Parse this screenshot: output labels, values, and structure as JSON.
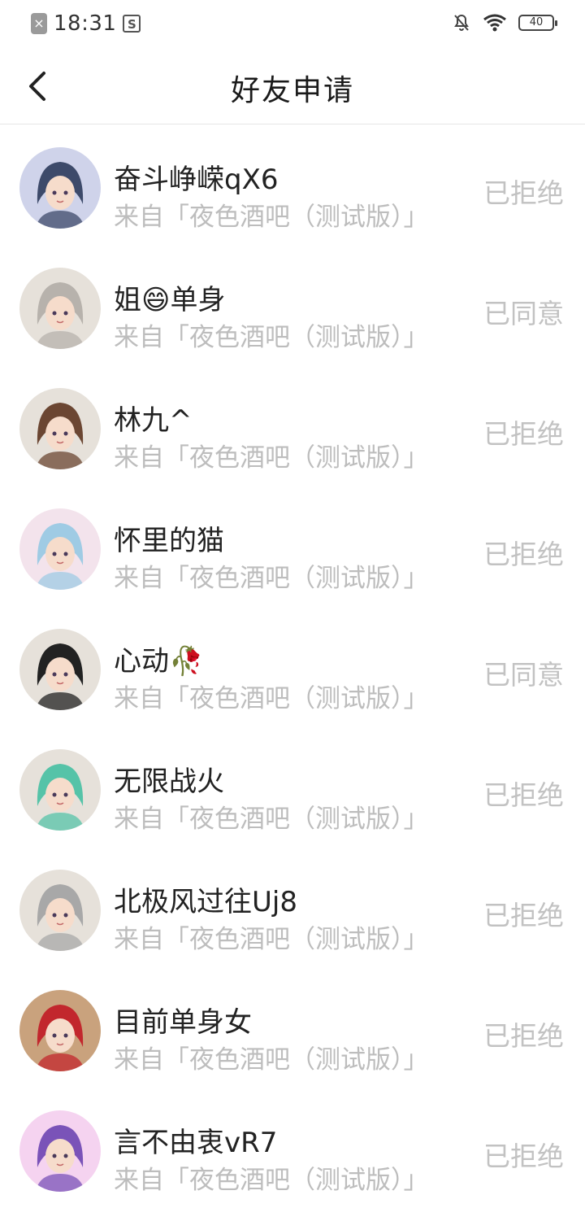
{
  "status_bar": {
    "time": "18:31",
    "battery": "40"
  },
  "header": {
    "title": "好友申请"
  },
  "requests": [
    {
      "name": "奋斗峥嵘qX6",
      "source": "来自「夜色酒吧（测试版）」",
      "status": "已拒绝",
      "avatar_icon": "avatar-boy-mic-icon",
      "avatar_colors": [
        "#cfd3ea",
        "#3d4a6a"
      ]
    },
    {
      "name": "姐😄单身",
      "source": "来自「夜色酒吧（测试版）」",
      "status": "已同意",
      "avatar_icon": "avatar-silver-hair-icon",
      "avatar_colors": [
        "#e6e1da",
        "#b7b2ac"
      ]
    },
    {
      "name": "林九^",
      "source": "来自「夜色酒吧（测试版）」",
      "status": "已拒绝",
      "avatar_icon": "avatar-brown-hair-icon",
      "avatar_colors": [
        "#e6e1da",
        "#6b4632"
      ]
    },
    {
      "name": "怀里的猫",
      "source": "来自「夜色酒吧（测试版）」",
      "status": "已拒绝",
      "avatar_icon": "avatar-pink-girl-icon",
      "avatar_colors": [
        "#f3e3ec",
        "#9fcbe4"
      ]
    },
    {
      "name": "心动🥀",
      "source": "来自「夜色酒吧（测试版）」",
      "status": "已同意",
      "avatar_icon": "avatar-black-hair-icon",
      "avatar_colors": [
        "#e6e1da",
        "#222222"
      ]
    },
    {
      "name": "无限战火",
      "source": "来自「夜色酒吧（测试版）」",
      "status": "已拒绝",
      "avatar_icon": "avatar-teal-hair-icon",
      "avatar_colors": [
        "#e6e1da",
        "#56c3a8"
      ]
    },
    {
      "name": "北极风过往Uj8",
      "source": "来自「夜色酒吧（测试版）」",
      "status": "已拒绝",
      "avatar_icon": "avatar-grey-hair-icon",
      "avatar_colors": [
        "#e6e1da",
        "#a8a8a8"
      ]
    },
    {
      "name": "目前单身女",
      "source": "来自「夜色酒吧（测试版）」",
      "status": "已拒绝",
      "avatar_icon": "avatar-red-hat-icon",
      "avatar_colors": [
        "#c9a27d",
        "#c2272d"
      ]
    },
    {
      "name": "言不由衷vR7",
      "source": "来自「夜色酒吧（测试版）」",
      "status": "已拒绝",
      "avatar_icon": "avatar-purple-hair-icon",
      "avatar_colors": [
        "#f5d3f0",
        "#7a53b8"
      ]
    }
  ]
}
